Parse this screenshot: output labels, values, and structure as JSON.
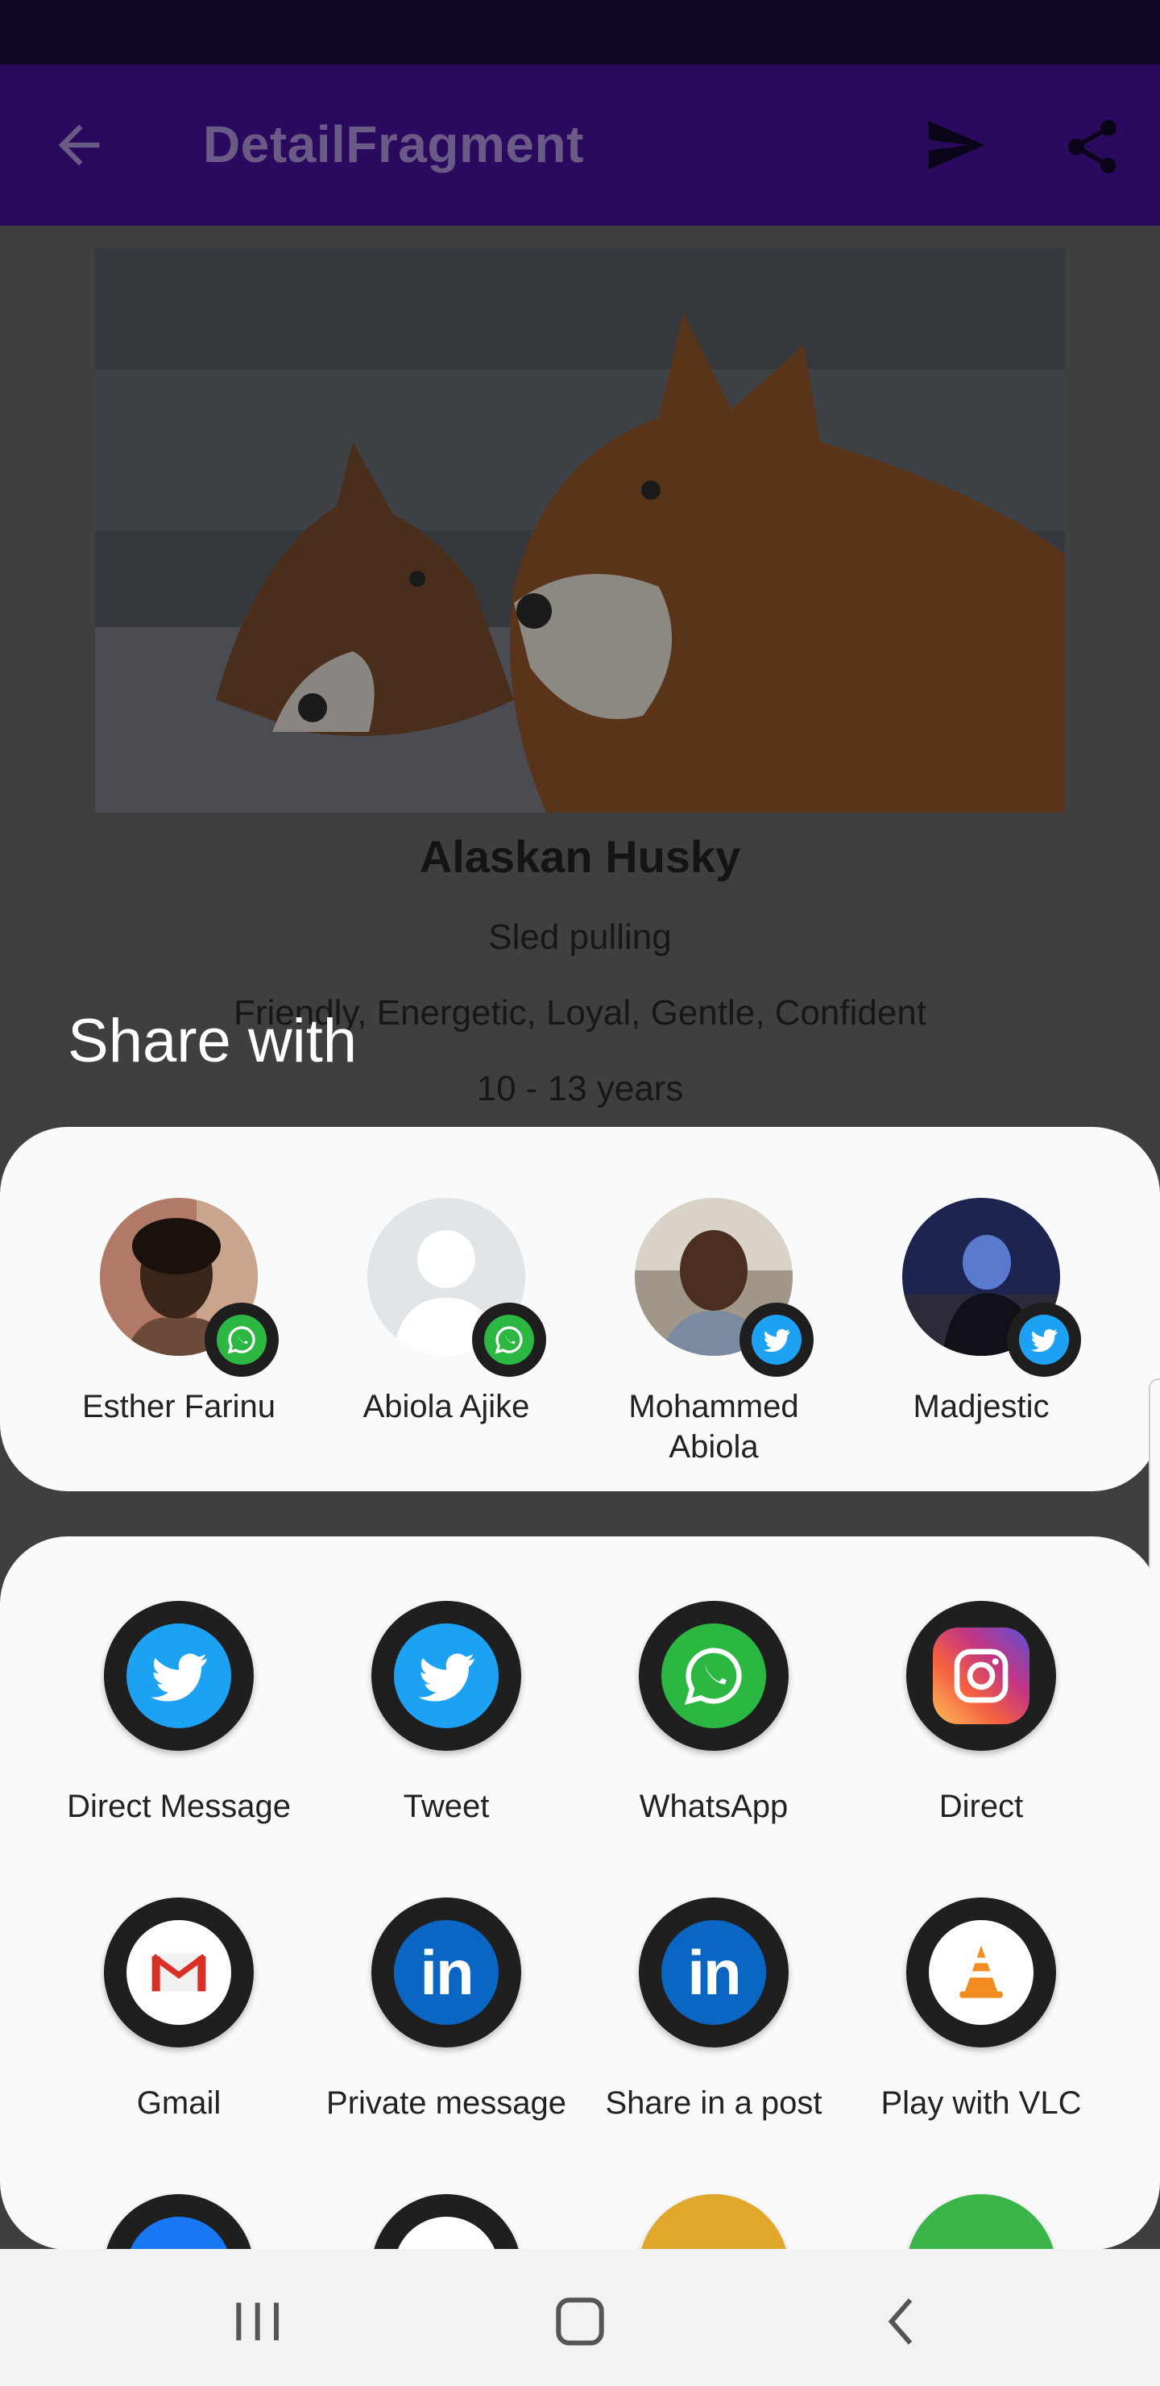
{
  "app_bar": {
    "title": "DetailFragment",
    "back_icon": "arrow-back-icon",
    "send_icon": "send-icon",
    "share_icon": "share-icon",
    "color": "#2a0a5e"
  },
  "detail": {
    "name": "Alaskan Husky",
    "bred_for": "Sled pulling",
    "temperament": "Friendly, Energetic, Loyal, Gentle, Confident",
    "life_span": "10 - 13 years"
  },
  "share_sheet": {
    "title": "Share with",
    "people": [
      {
        "name": "Esther Farinu",
        "app": "whatsapp-icon"
      },
      {
        "name": "Abiola Ajike",
        "app": "whatsapp-icon"
      },
      {
        "name": "Mohammed Abiola",
        "app": "twitter-icon"
      },
      {
        "name": "Madjestic",
        "app": "twitter-icon"
      }
    ],
    "apps": [
      {
        "label": "Direct Message",
        "icon": "twitter-icon"
      },
      {
        "label": "Tweet",
        "icon": "twitter-icon"
      },
      {
        "label": "WhatsApp",
        "icon": "whatsapp-icon"
      },
      {
        "label": "Direct",
        "icon": "instagram-icon"
      },
      {
        "label": "Gmail",
        "icon": "gmail-icon"
      },
      {
        "label": "Private message",
        "icon": "linkedin-icon"
      },
      {
        "label": "Share in a post",
        "icon": "linkedin-icon"
      },
      {
        "label": "Play with VLC",
        "icon": "vlc-icon"
      }
    ]
  },
  "nav_bar": {
    "recents_icon": "recents-icon",
    "home_icon": "home-icon",
    "back_icon": "nav-back-icon"
  }
}
